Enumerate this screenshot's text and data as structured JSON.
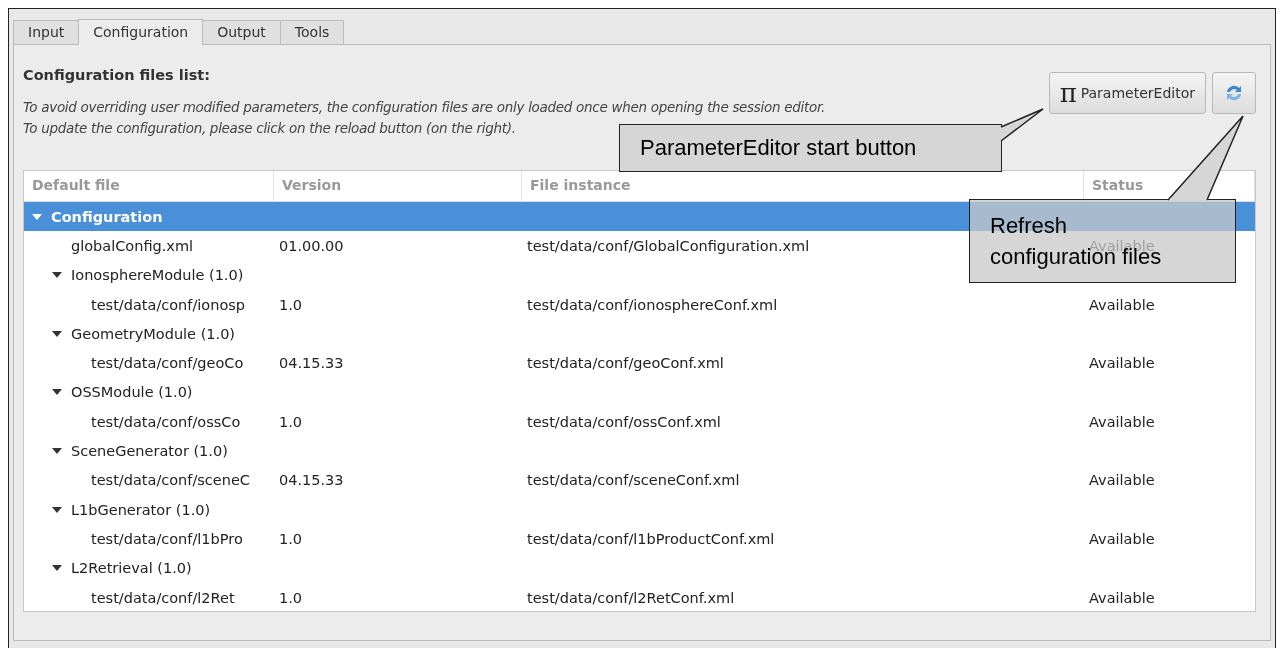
{
  "tabs": [
    {
      "label": "Input",
      "selected": false
    },
    {
      "label": "Configuration",
      "selected": true
    },
    {
      "label": "Output",
      "selected": false
    },
    {
      "label": "Tools",
      "selected": false
    }
  ],
  "heading": "Configuration files list:",
  "notes": [
    "To avoid  overriding user modified parameters, the configuration files are only loaded once when opening the session editor.",
    "To update the configuration, please click on the reload button (on the right)."
  ],
  "parameter_editor_button": {
    "symbol": "π",
    "label": "ParameterEditor"
  },
  "tree": {
    "columns": [
      "Default file",
      "Version",
      "File instance",
      "Status"
    ],
    "items": [
      {
        "label": "Configuration",
        "expanded": true,
        "selected": true,
        "children": [
          {
            "label": "globalConfig.xml",
            "version": "01.00.00",
            "file_instance": "test/data/conf/GlobalConfiguration.xml",
            "status": "Available",
            "selected": false
          },
          {
            "label": "IonosphereModule (1.0)",
            "expanded": true,
            "selected": false,
            "children": [
              {
                "label": "test/data/conf/ionosp",
                "version": "1.0",
                "file_instance": "test/data/conf/ionosphereConf.xml",
                "status": "Available",
                "selected": false
              }
            ]
          },
          {
            "label": "GeometryModule (1.0)",
            "expanded": true,
            "selected": false,
            "children": [
              {
                "label": "test/data/conf/geoCo",
                "version": "04.15.33",
                "file_instance": "test/data/conf/geoConf.xml",
                "status": "Available",
                "selected": false
              }
            ]
          },
          {
            "label": "OSSModule (1.0)",
            "expanded": true,
            "selected": false,
            "children": [
              {
                "label": "test/data/conf/ossCo",
                "version": "1.0",
                "file_instance": "test/data/conf/ossConf.xml",
                "status": "Available",
                "selected": false
              }
            ]
          },
          {
            "label": "SceneGenerator (1.0)",
            "expanded": true,
            "selected": false,
            "children": [
              {
                "label": "test/data/conf/sceneC",
                "version": "04.15.33",
                "file_instance": "test/data/conf/sceneConf.xml",
                "status": "Available",
                "selected": false
              }
            ]
          },
          {
            "label": "L1bGenerator (1.0)",
            "expanded": true,
            "selected": false,
            "children": [
              {
                "label": "test/data/conf/l1bPro",
                "version": "1.0",
                "file_instance": "test/data/conf/l1bProductConf.xml",
                "status": "Available",
                "selected": false
              }
            ]
          },
          {
            "label": "L2Retrieval (1.0)",
            "expanded": true,
            "selected": false,
            "children": [
              {
                "label": "test/data/conf/l2Ret",
                "version": "1.0",
                "file_instance": "test/data/conf/l2RetConf.xml",
                "status": "Available",
                "selected": false
              }
            ]
          }
        ]
      }
    ]
  },
  "callouts": [
    {
      "text": "ParameterEditor start button"
    },
    {
      "text": "Refresh configuration files"
    }
  ]
}
